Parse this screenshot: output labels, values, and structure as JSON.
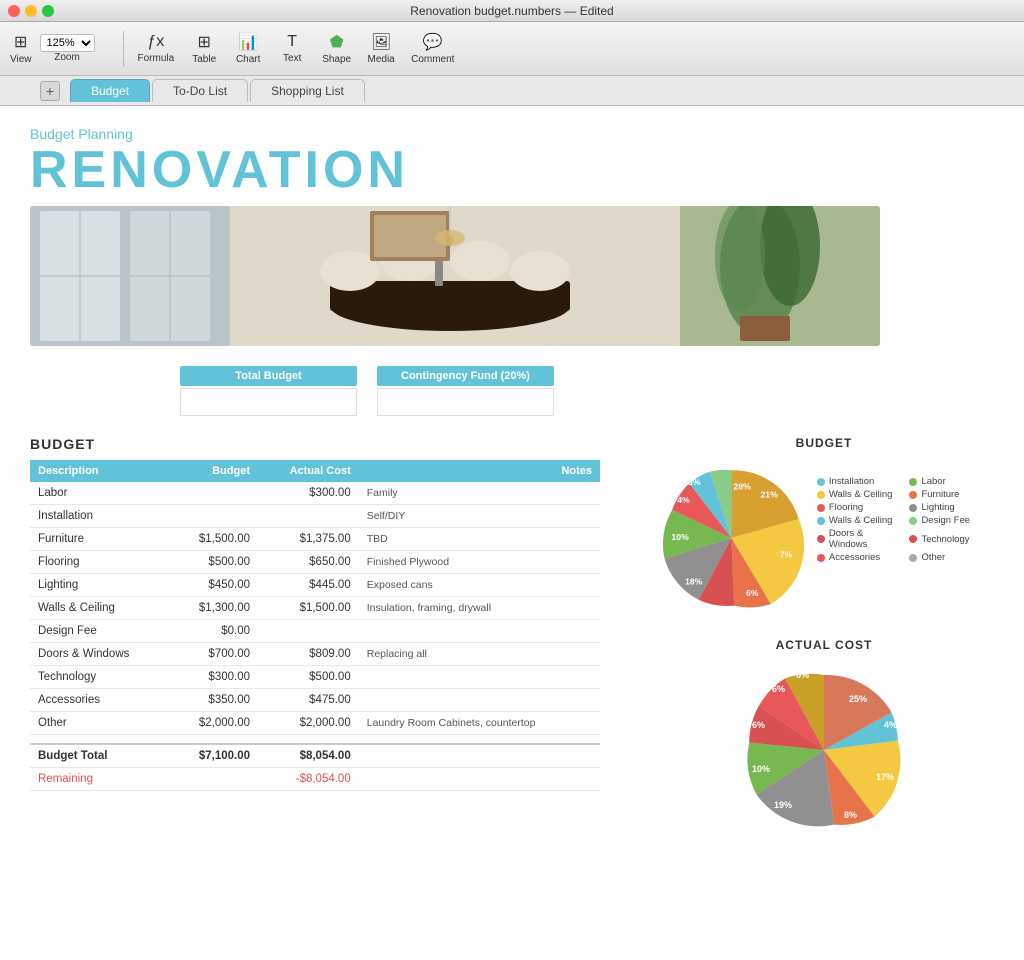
{
  "window": {
    "title": "Renovation budget.numbers — Edited"
  },
  "toolbar": {
    "view_label": "View",
    "zoom_value": "125%",
    "zoom_label": "Zoom",
    "formula_label": "Formula",
    "table_label": "Table",
    "chart_label": "Chart",
    "text_label": "Text",
    "shape_label": "Shape",
    "media_label": "Media",
    "comment_label": "Comment"
  },
  "tabs": [
    {
      "label": "Budget",
      "active": true
    },
    {
      "label": "To-Do List",
      "active": false
    },
    {
      "label": "Shopping List",
      "active": false
    }
  ],
  "header": {
    "subtitle": "Budget Planning",
    "title": "RENOVATION"
  },
  "budget_inputs": {
    "total_budget_label": "Total Budget",
    "contingency_label": "Contingency Fund (20%)",
    "total_budget_value": "",
    "contingency_value": ""
  },
  "budget_section_title": "BUDGET",
  "table_headers": [
    "Description",
    "Budget",
    "Actual Cost",
    "Notes"
  ],
  "table_rows": [
    {
      "desc": "Labor",
      "budget": "",
      "actual": "$300.00",
      "notes": "Family"
    },
    {
      "desc": "Installation",
      "budget": "",
      "actual": "",
      "notes": "Self/DIY"
    },
    {
      "desc": "Furniture",
      "budget": "$1,500.00",
      "actual": "$1,375.00",
      "notes": "TBD"
    },
    {
      "desc": "Flooring",
      "budget": "$500.00",
      "actual": "$650.00",
      "notes": "Finished Plywood"
    },
    {
      "desc": "Lighting",
      "budget": "$450.00",
      "actual": "$445.00",
      "notes": "Exposed cans"
    },
    {
      "desc": "Walls & Ceiling",
      "budget": "$1,300.00",
      "actual": "$1,500.00",
      "notes": "Insulation, framing, drywall"
    },
    {
      "desc": "Design Fee",
      "budget": "$0.00",
      "actual": "",
      "notes": ""
    },
    {
      "desc": "Doors & Windows",
      "budget": "$700.00",
      "actual": "$809.00",
      "notes": "Replacing all"
    },
    {
      "desc": "Technology",
      "budget": "$300.00",
      "actual": "$500.00",
      "notes": ""
    },
    {
      "desc": "Accessories",
      "budget": "$350.00",
      "actual": "$475.00",
      "notes": ""
    },
    {
      "desc": "Other",
      "budget": "$2,000.00",
      "actual": "$2,000.00",
      "notes": "Laundry Room Cabinets, countertop"
    }
  ],
  "totals": {
    "budget_total_label": "Budget Total",
    "budget_total_budget": "$7,100.00",
    "budget_total_actual": "$8,054.00",
    "remaining_label": "Remaining",
    "remaining_actual": "-$8,054.00"
  },
  "budget_chart": {
    "title": "BUDGET",
    "slices": [
      {
        "label": "Installation",
        "pct": "21%",
        "color": "#f5c842",
        "value": 21
      },
      {
        "label": "Labor",
        "pct": "7%",
        "color": "#e8734a",
        "value": 7
      },
      {
        "label": "Furniture",
        "pct": "6%",
        "color": "#d85050",
        "value": 6
      },
      {
        "label": "Walls & Ceiling",
        "pct": "18%",
        "color": "#909090",
        "value": 18
      },
      {
        "label": "Flooring",
        "pct": "10%",
        "color": "#78b850",
        "value": 10
      },
      {
        "label": "Doors & Windows",
        "pct": "4%",
        "color": "#62c3d8",
        "value": 4
      },
      {
        "label": "Accessories",
        "pct": "5%",
        "color": "#e85858",
        "value": 5
      },
      {
        "label": "Lighting",
        "pct": "28%",
        "color": "#d8a030",
        "value": 28
      },
      {
        "label": "Design Fee",
        "pct": "",
        "color": "#88cc88",
        "value": 1
      }
    ],
    "legend": [
      {
        "label": "Installation",
        "color": "#62c3d8"
      },
      {
        "label": "Labor",
        "color": "#78b850"
      },
      {
        "label": "Walls & Ceiling",
        "color": "#f5c842"
      },
      {
        "label": "Furniture",
        "color": "#e8734a"
      },
      {
        "label": "Flooring",
        "color": "#e85858"
      },
      {
        "label": "Lighting",
        "color": "#909090"
      },
      {
        "label": "Walls & Ceiling",
        "color": "#62c3d8"
      },
      {
        "label": "Design Fee",
        "color": "#88cc88"
      },
      {
        "label": "Doors & Windows",
        "color": "#d85050"
      },
      {
        "label": "Technology",
        "color": "#e05050"
      },
      {
        "label": "Accessories",
        "color": "#e85858"
      },
      {
        "label": "Other",
        "color": "#aaaaaa"
      }
    ]
  },
  "actual_chart": {
    "title": "ACTUAL COST",
    "slices": [
      {
        "label": "Installation",
        "pct": "4%",
        "color": "#62c3d8",
        "value": 4
      },
      {
        "label": "Labor",
        "pct": "17%",
        "color": "#f5c842",
        "value": 17
      },
      {
        "label": "Furniture",
        "pct": "8%",
        "color": "#e8734a",
        "value": 8
      },
      {
        "label": "Walls & Ceiling",
        "pct": "19%",
        "color": "#909090",
        "value": 19
      },
      {
        "label": "Flooring",
        "pct": "10%",
        "color": "#78b850",
        "value": 10
      },
      {
        "label": "Doors & Windows",
        "pct": "6%",
        "color": "#d85050",
        "value": 6
      },
      {
        "label": "Accessories",
        "pct": "6%",
        "color": "#e85858",
        "value": 6
      },
      {
        "label": "Lighting",
        "pct": "6%",
        "color": "#c8a028",
        "value": 6
      },
      {
        "label": "Other",
        "pct": "25%",
        "color": "#d8785a",
        "value": 25
      }
    ]
  }
}
